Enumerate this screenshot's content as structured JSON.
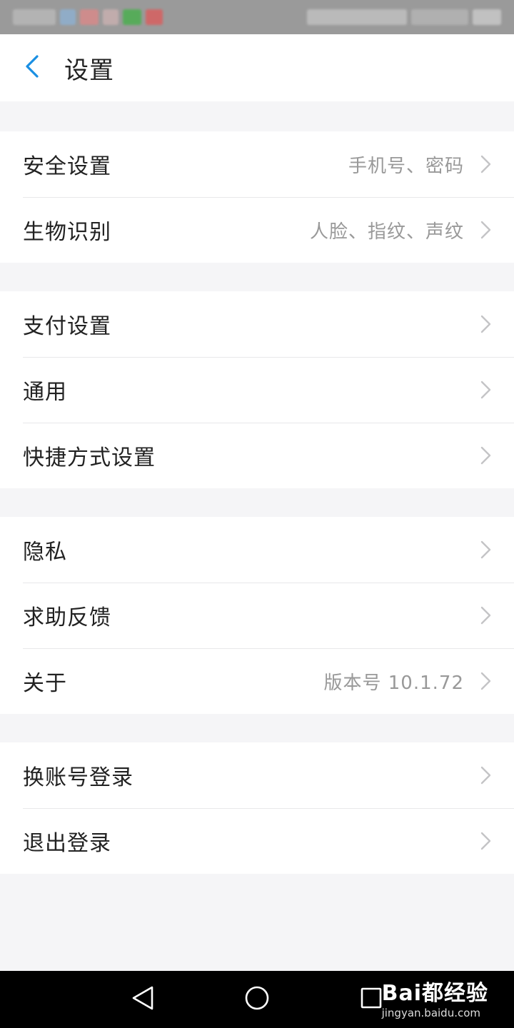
{
  "header": {
    "title": "设置"
  },
  "groups": [
    {
      "rows": [
        {
          "label": "安全设置",
          "value": "手机号、密码"
        },
        {
          "label": "生物识别",
          "value": "人脸、指纹、声纹"
        }
      ]
    },
    {
      "rows": [
        {
          "label": "支付设置",
          "value": ""
        },
        {
          "label": "通用",
          "value": ""
        },
        {
          "label": "快捷方式设置",
          "value": ""
        }
      ]
    },
    {
      "rows": [
        {
          "label": "隐私",
          "value": ""
        },
        {
          "label": "求助反馈",
          "value": ""
        },
        {
          "label": "关于",
          "value": "版本号 10.1.72"
        }
      ]
    },
    {
      "rows": [
        {
          "label": "换账号登录",
          "value": ""
        },
        {
          "label": "退出登录",
          "value": ""
        }
      ]
    }
  ],
  "watermark": {
    "brand": "Bai都经验",
    "url": "jingyan.baidu.com"
  },
  "colors": {
    "accent": "#1a8fe3",
    "chevron": "#c4c4c6",
    "separator": "#e8e8ea",
    "background": "#f5f5f7"
  }
}
